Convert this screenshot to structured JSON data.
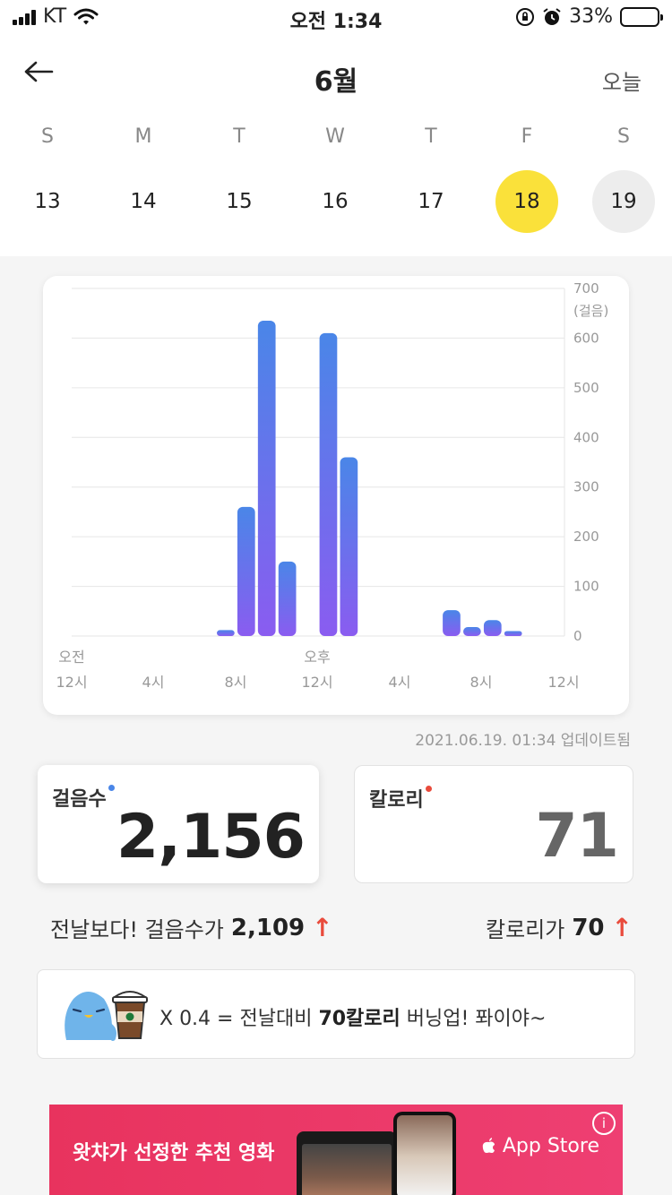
{
  "status": {
    "carrier": "KT",
    "time": "오전 1:34",
    "battery": "33%"
  },
  "header": {
    "month": "6월",
    "today_label": "오늘",
    "weekdays": [
      "S",
      "M",
      "T",
      "W",
      "T",
      "F",
      "S"
    ],
    "dates": [
      "13",
      "14",
      "15",
      "16",
      "17",
      "18",
      "19"
    ],
    "selected_date": "18",
    "selected_color": "#fae13a"
  },
  "chart_data": {
    "type": "bar",
    "title": "",
    "ylabel": "(걸음)",
    "ylim": [
      0,
      700
    ],
    "yticks": [
      "0",
      "100",
      "200",
      "300",
      "400",
      "500",
      "600",
      "700"
    ],
    "x_labels_top": [
      "오전",
      "",
      "",
      "오후",
      "",
      "",
      ""
    ],
    "x_labels": [
      "12시",
      "4시",
      "8시",
      "12시",
      "4시",
      "8시",
      "12시"
    ],
    "categories": [
      "0",
      "1",
      "2",
      "3",
      "4",
      "5",
      "6",
      "7",
      "8",
      "9",
      "10",
      "11",
      "12",
      "13",
      "14",
      "15",
      "16",
      "17",
      "18",
      "19",
      "20",
      "21",
      "22",
      "23"
    ],
    "values": [
      0,
      0,
      0,
      0,
      0,
      0,
      0,
      12,
      260,
      635,
      150,
      0,
      610,
      360,
      0,
      0,
      0,
      0,
      52,
      18,
      32,
      10,
      0,
      0
    ],
    "bar_gradient": [
      "#4a86e8",
      "#8a5cf0"
    ]
  },
  "updated_text": "2021.06.19. 01:34 업데이트됨",
  "stats": {
    "steps_label": "걸음수",
    "steps_value": "2,156",
    "steps_dot_color": "#4a86e8",
    "calorie_label": "칼로리",
    "calorie_value": "71",
    "calorie_dot_color": "#e94b3c"
  },
  "compare": {
    "steps_prefix": "전날보다! 걸음수가",
    "steps_value": "2,109",
    "calorie_prefix": "칼로리가",
    "calorie_value": "70",
    "arrow": "↑"
  },
  "burn": {
    "text_prefix": "X 0.4 = 전날대비 ",
    "text_bold": "70칼로리",
    "text_suffix": " 버닝업! 퐈이야~"
  },
  "ad": {
    "title": "왓챠가 선정한 추천 영화",
    "store": " App Store",
    "info": "i"
  }
}
